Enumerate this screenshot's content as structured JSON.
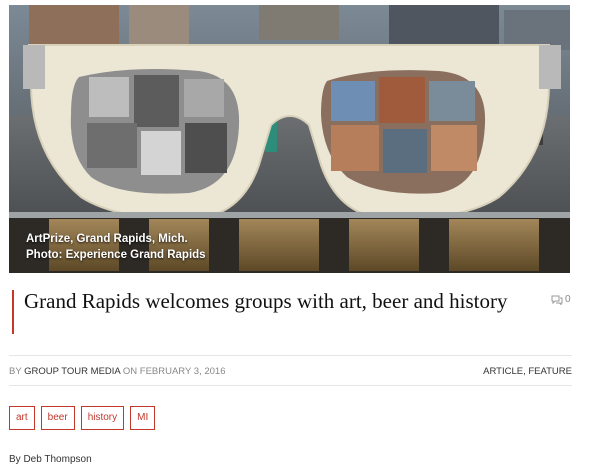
{
  "hero": {
    "caption_line1": "ArtPrize, Grand Rapids, Mich.",
    "caption_line2": "Photo: Experience Grand Rapids"
  },
  "article": {
    "title": "Grand Rapids welcomes groups with art, beer and history",
    "comment_count": "0",
    "meta": {
      "by": "BY",
      "author": "GROUP TOUR MEDIA",
      "on": "ON",
      "date": "FEBRUARY 3, 2016"
    },
    "categories": [
      "ARTICLE",
      "FEATURE"
    ],
    "tags": [
      "art",
      "beer",
      "history",
      "MI"
    ],
    "byline": "By Deb Thompson"
  },
  "colors": {
    "accent": "#c0392b",
    "text": "#111111",
    "muted": "#888888"
  },
  "icons": {
    "comments": "speech-bubbles-icon"
  }
}
